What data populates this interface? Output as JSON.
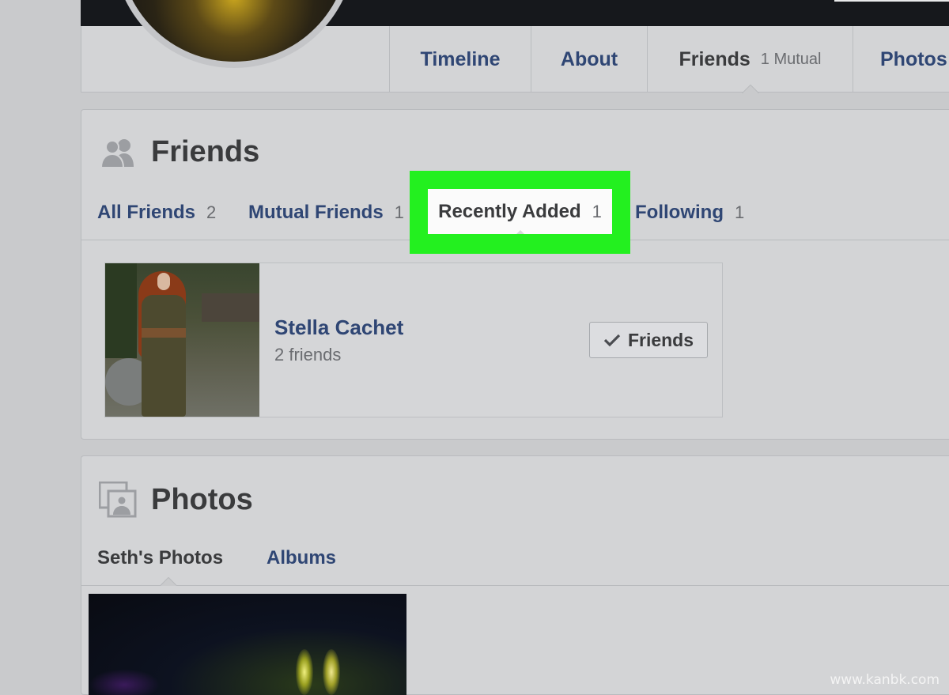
{
  "profile": {
    "nav_tabs": [
      {
        "label": "Timeline"
      },
      {
        "label": "About"
      },
      {
        "label": "Friends",
        "count": "1 Mutual",
        "active": true
      },
      {
        "label": "Photos"
      }
    ]
  },
  "friends_section": {
    "title": "Friends",
    "icon": "friends-icon",
    "tabs": [
      {
        "label": "All Friends",
        "count": "2"
      },
      {
        "label": "Mutual Friends",
        "count": "1"
      },
      {
        "label": "Recently Added",
        "count": "1",
        "active": true
      },
      {
        "label": "Following",
        "count": "1"
      }
    ],
    "friend": {
      "name": "Stella Cachet",
      "subtitle": "2 friends",
      "button_label": "Friends",
      "button_icon": "checkmark-icon"
    }
  },
  "photos_section": {
    "title": "Photos",
    "icon": "photos-icon",
    "tabs": [
      {
        "label": "Seth's Photos",
        "active": true
      },
      {
        "label": "Albums"
      }
    ]
  },
  "highlight_color": "#23f01f",
  "link_color": "#2f4674",
  "watermark": "www.kanbk.com"
}
